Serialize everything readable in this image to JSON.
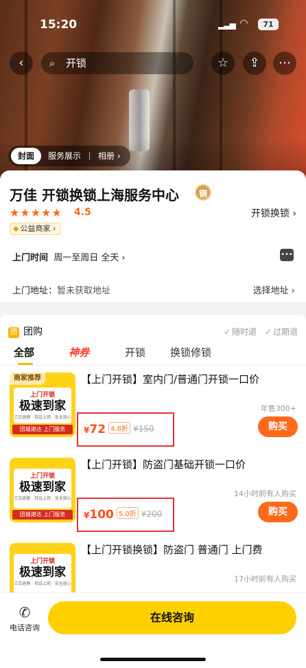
{
  "status_bar": {
    "time": "15:20",
    "battery": "71"
  },
  "nav": {
    "search_text": "开锁"
  },
  "media_tabs": [
    "封面",
    "服务展示",
    "相册 ›"
  ],
  "shop": {
    "name": "万佳 开锁换锁上海服务中心",
    "medal": "铜",
    "stars": "★★★★★",
    "rating": "4.5",
    "category": "开锁换锁 ›",
    "badge": "公益商家 ›",
    "hours_label": "上门时间",
    "hours_value": "周一至周日 全天 ›",
    "address_label": "上门地址：",
    "address_value": "暂未获取地址",
    "choose_address": "选择地址 ›"
  },
  "group_buy": {
    "icon": "团",
    "label": "团购",
    "guarantees": [
      "随时退",
      "过期退"
    ],
    "tabs": [
      "全部",
      "神券",
      "开锁",
      "换锁修锁"
    ],
    "deals": [
      {
        "tag": "商家推荐",
        "thumb_small": "上门开锁",
        "thumb_big": "极速到家",
        "thumb_tiny": "三日退换 · 持证上岗 · 安全放心",
        "thumb_foot": "团城速达 上门服务",
        "title": "【上门开锁】室内门/普通门开锁一口价",
        "sold": "年售300+",
        "price": "72",
        "discount": "4.8折",
        "original": "¥150",
        "buy": "购买"
      },
      {
        "tag": "",
        "thumb_small": "上门开锁",
        "thumb_big": "极速到家",
        "thumb_tiny": "三日退换 · 持证上岗 · 安全放心",
        "thumb_foot": "团城速达 上门服务",
        "title": "【上门开锁】防盗门基础开锁一口价",
        "sold": "14小时前有人购买",
        "price": "100",
        "discount": "5.0折",
        "original": "¥200",
        "buy": "购买"
      },
      {
        "tag": "",
        "thumb_small": "上门开锁",
        "thumb_big": "极速到家",
        "thumb_tiny": "三日退换 · 持证上岗 · 安全放心",
        "thumb_foot": "",
        "title": "【上门开锁换锁】防盗门 普通门 上门费",
        "sold": "17小时前有人购买",
        "price": "",
        "discount": "",
        "original": "",
        "buy": ""
      }
    ]
  },
  "bottom": {
    "phone_label": "电话咨询",
    "consult_label": "在线咨询"
  },
  "yen": "¥"
}
